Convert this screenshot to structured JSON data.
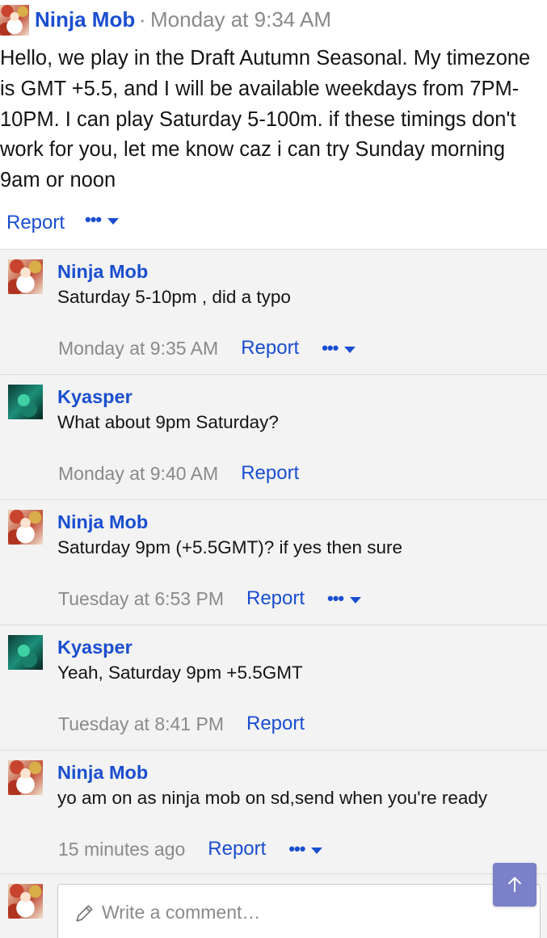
{
  "post": {
    "author": "Ninja Mob",
    "separator": "·",
    "time": "Monday at 9:34 AM",
    "body": "Hello, we play in the Draft Autumn Seasonal. My timezone is GMT +5.5, and I will be available weekdays from 7PM-10PM. I can play Saturday 5-100m. if these timings don't work for you, let me know caz i can try Sunday morning 9am or noon",
    "report_label": "Report",
    "more_dots": "•••"
  },
  "comments": [
    {
      "author": "Ninja Mob",
      "avatar": "ninja-avatar",
      "text": "Saturday 5-10pm , did a typo",
      "time": "Monday at 9:35 AM",
      "report_label": "Report",
      "has_more": true
    },
    {
      "author": "Kyasper",
      "avatar": "kyasper-avatar",
      "text": "What about 9pm Saturday?",
      "time": "Monday at 9:40 AM",
      "report_label": "Report",
      "has_more": false
    },
    {
      "author": "Ninja Mob",
      "avatar": "ninja-avatar",
      "text": "Saturday 9pm (+5.5GMT)? if yes then sure",
      "time": "Tuesday at 6:53 PM",
      "report_label": "Report",
      "has_more": true
    },
    {
      "author": "Kyasper",
      "avatar": "kyasper-avatar",
      "text": "Yeah, Saturday 9pm +5.5GMT",
      "time": "Tuesday at 8:41 PM",
      "report_label": "Report",
      "has_more": false
    },
    {
      "author": "Ninja Mob",
      "avatar": "ninja-avatar",
      "text": "yo am on as ninja mob on sd,send when you're ready",
      "time": "15 minutes ago",
      "report_label": "Report",
      "has_more": true
    }
  ],
  "compose": {
    "placeholder": "Write a comment…",
    "icon": "pencil-icon"
  },
  "more_dots": "•••",
  "colors": {
    "link": "#1a4ecf",
    "muted": "#8a8a8a",
    "comment_bg": "#f3f3f3",
    "scroll_button": "#7b80c9"
  }
}
